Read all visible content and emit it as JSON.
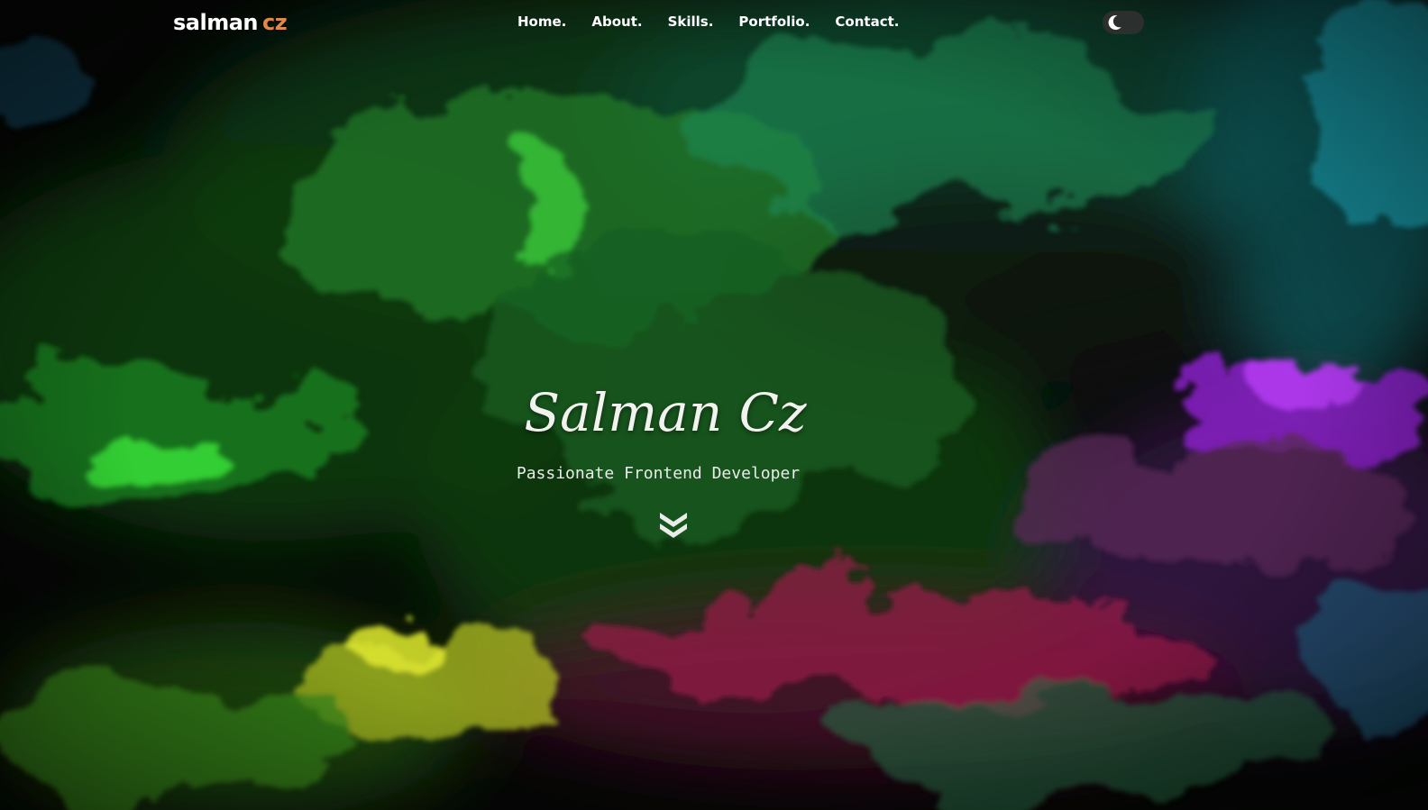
{
  "colors": {
    "background": "#060806",
    "text": "#ffffff",
    "accent": "#e0894a",
    "toggle_track": "#2b2f2d"
  },
  "header": {
    "logo": {
      "main": "salman",
      "accent": "cz"
    },
    "nav": [
      {
        "label": "Home.",
        "icon": "none"
      },
      {
        "label": "About.",
        "icon": "none"
      },
      {
        "label": "Skills.",
        "icon": "none"
      },
      {
        "label": "Portfolio.",
        "icon": "none"
      },
      {
        "label": "Contact.",
        "icon": "none"
      }
    ],
    "theme_toggle": {
      "icon": "moon-icon",
      "state": "dark"
    }
  },
  "hero": {
    "title": "Salman Cz",
    "subtitle": "Passionate Frontend Developer",
    "scroll_icon": "double-chevron-down-icon",
    "background": "abstract-fluid-art-green-purple-pink"
  }
}
